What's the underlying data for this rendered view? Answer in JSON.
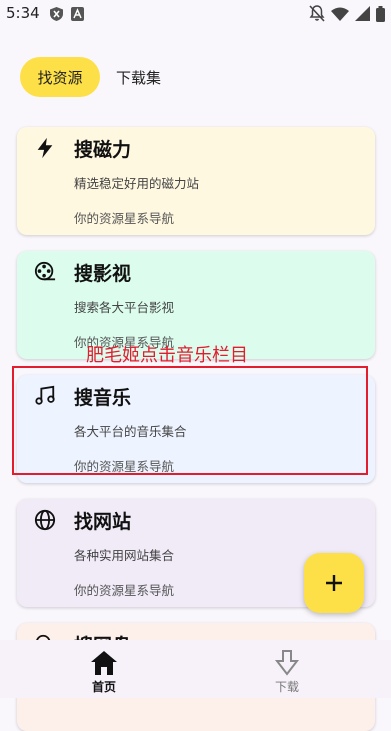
{
  "status_bar": {
    "time": "5:34",
    "left_icons": [
      "shield-icon",
      "a-box-icon"
    ],
    "right_icons": [
      "notifications-off-icon",
      "wifi-icon",
      "signal-icon",
      "battery-icon"
    ]
  },
  "tabs": [
    {
      "label": "找资源",
      "active": true
    },
    {
      "label": "下载集",
      "active": false
    }
  ],
  "cards": [
    {
      "icon": "lightning-icon",
      "title": "搜磁力",
      "subtitle": "精选稳定好用的磁力站",
      "footer": "你的资源星系导航",
      "bg": "#fff8e1"
    },
    {
      "icon": "film-reel-icon",
      "title": "搜影视",
      "subtitle": "搜索各大平台影视",
      "footer": "你的资源星系导航",
      "bg": "#dcfdee"
    },
    {
      "icon": "music-note-icon",
      "title": "搜音乐",
      "subtitle": "各大平台的音乐集合",
      "footer": "你的资源星系导航",
      "bg": "#eef4ff"
    },
    {
      "icon": "globe-icon",
      "title": "找网站",
      "subtitle": "各种实用网站集合",
      "footer": "你的资源星系导航",
      "bg": "#f1ebf8"
    },
    {
      "icon": "search-icon",
      "title": "搜网盘",
      "subtitle": "",
      "footer": "",
      "bg": "#fdf0ea"
    }
  ],
  "annotation": {
    "text": "肥毛姬点击音乐栏目",
    "color": "#e11d2e"
  },
  "fab": {
    "label": "+",
    "color": "#fde047"
  },
  "bottom_nav": [
    {
      "icon": "home-icon",
      "label": "首页",
      "active": true
    },
    {
      "icon": "download-icon",
      "label": "下载",
      "active": false
    }
  ],
  "colors": {
    "accent": "#fde047",
    "highlight": "#e11d2e",
    "background": "#faf7fc"
  }
}
